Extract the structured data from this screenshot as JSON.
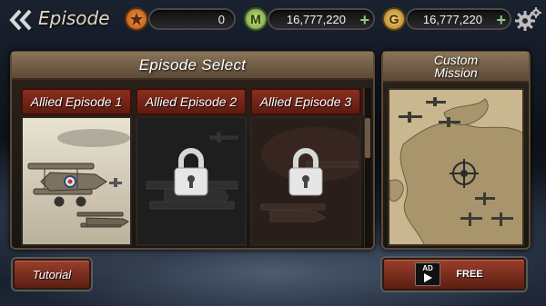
{
  "header": {
    "title": "Episode",
    "stars": "0",
    "medals": "16,777,220",
    "gold": "16,777,220",
    "medal_symbol": "M",
    "gold_symbol": "G"
  },
  "episode_select": {
    "title": "Episode Select",
    "episodes": [
      {
        "label": "Allied Episode 1",
        "locked": false
      },
      {
        "label": "Allied Episode 2",
        "locked": true
      },
      {
        "label": "Allied Episode 3",
        "locked": true
      }
    ]
  },
  "custom_mission": {
    "title_line1": "Custom",
    "title_line2": "Mission"
  },
  "buttons": {
    "tutorial": "Tutorial",
    "ad_badge": "AD",
    "free": "FREE"
  },
  "colors": {
    "panel_header": "#7a654d",
    "tab_red": "#7d2a1b",
    "star_orange": "#e37a2a",
    "medal_green": "#8fbf55",
    "gold_coin": "#d6a640"
  },
  "icons": [
    "back-chevrons-icon",
    "star-icon",
    "medal-icon",
    "gold-icon",
    "plus-icon",
    "settings-gears-icon",
    "padlock-icon",
    "play-icon"
  ]
}
